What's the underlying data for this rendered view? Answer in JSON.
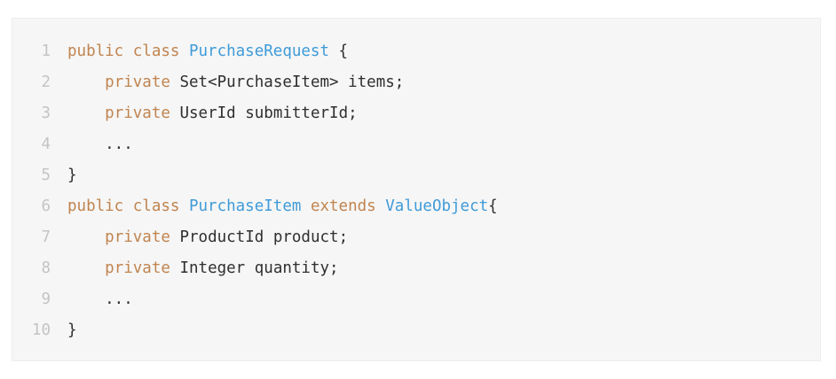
{
  "code": {
    "lines": [
      {
        "number": "1",
        "tokens": [
          {
            "text": "public class ",
            "kind": "kw"
          },
          {
            "text": "PurchaseRequest",
            "kind": "ty"
          },
          {
            "text": " {",
            "kind": "pl"
          }
        ]
      },
      {
        "number": "2",
        "tokens": [
          {
            "text": "    ",
            "kind": "pl"
          },
          {
            "text": "private",
            "kind": "kw"
          },
          {
            "text": " Set<PurchaseItem> items;",
            "kind": "pl"
          }
        ]
      },
      {
        "number": "3",
        "tokens": [
          {
            "text": "    ",
            "kind": "pl"
          },
          {
            "text": "private",
            "kind": "kw"
          },
          {
            "text": " UserId submitterId;",
            "kind": "pl"
          }
        ]
      },
      {
        "number": "4",
        "tokens": [
          {
            "text": "    ...",
            "kind": "pl"
          }
        ]
      },
      {
        "number": "5",
        "tokens": [
          {
            "text": "}",
            "kind": "pl"
          }
        ]
      },
      {
        "number": "6",
        "tokens": [
          {
            "text": "public class ",
            "kind": "kw"
          },
          {
            "text": "PurchaseItem",
            "kind": "ty"
          },
          {
            "text": " ",
            "kind": "pl"
          },
          {
            "text": "extends",
            "kind": "kw"
          },
          {
            "text": " ",
            "kind": "pl"
          },
          {
            "text": "ValueObject",
            "kind": "ty"
          },
          {
            "text": "{",
            "kind": "pl"
          }
        ]
      },
      {
        "number": "7",
        "tokens": [
          {
            "text": "    ",
            "kind": "pl"
          },
          {
            "text": "private",
            "kind": "kw"
          },
          {
            "text": " ProductId product;",
            "kind": "pl"
          }
        ]
      },
      {
        "number": "8",
        "tokens": [
          {
            "text": "    ",
            "kind": "pl"
          },
          {
            "text": "private",
            "kind": "kw"
          },
          {
            "text": " Integer quantity;",
            "kind": "pl"
          }
        ]
      },
      {
        "number": "9",
        "tokens": [
          {
            "text": "    ...",
            "kind": "pl"
          }
        ]
      },
      {
        "number": "10",
        "tokens": [
          {
            "text": "}",
            "kind": "pl"
          }
        ]
      }
    ]
  },
  "colors": {
    "keyword": "#c0844f",
    "type": "#3f9bd8",
    "plain": "#2f2f2f",
    "line_number": "#c4c4c4",
    "background": "#f6f6f6"
  }
}
